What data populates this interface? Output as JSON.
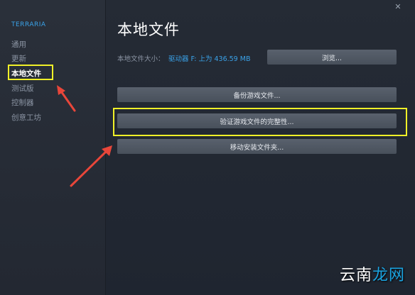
{
  "sidebar": {
    "game_title": "TERRARIA",
    "items": [
      {
        "label": "通用"
      },
      {
        "label": "更新"
      },
      {
        "label": "本地文件",
        "active": true
      },
      {
        "label": "测试版"
      },
      {
        "label": "控制器"
      },
      {
        "label": "创意工坊"
      }
    ]
  },
  "main": {
    "title": "本地文件",
    "size_label": "本地文件大小：",
    "size_value": "驱动器 F: 上为 436.59 MB",
    "browse_button": "浏览...",
    "backup_button": "备份游戏文件...",
    "verify_button": "验证游戏文件的完整性...",
    "move_button": "移动安装文件夹..."
  },
  "window": {
    "close_icon": "close-icon"
  },
  "watermark": {
    "text_left": "云南",
    "text_right": "龙网"
  },
  "colors": {
    "accent": "#3aa2e8",
    "highlight": "#f0f028",
    "arrow": "#e8463a"
  }
}
